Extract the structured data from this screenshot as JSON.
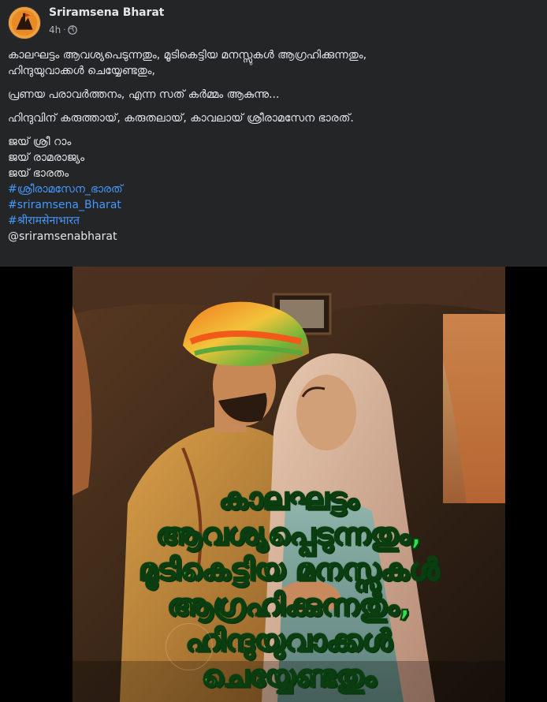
{
  "post": {
    "author": "Sriramsena Bharat",
    "time": "4h",
    "time_separator": "·",
    "audience_icon": "globe-icon",
    "caption": {
      "line1": "കാലഘട്ടം ആവശ്യപെടുന്നതും, മൂടികെട്ടിയ മനസ്സുകൾ ആഗ്രഹിക്കുന്നതും,",
      "line2": "ഹിന്ദുയുവാക്കൾ ചെയ്യേണ്ടതും,",
      "line3": "പ്രണയ പരാവർത്തനം, എന്ന സത് കർമ്മം ആകുന്നു...",
      "line4": "ഹിന്ദുവിന് കരുത്തായ്, കരുതലായ്, കാവലായ് ശ്രീരാമസേന ഭാരത്.",
      "line5": "ജയ് ശ്രീ റാം",
      "line6": "ജയ് രാമരാജ്യം",
      "line7": "ജയ്  ഭാരതം",
      "hashtag1": "#ശ്രീരാമസേന_ഭാരത്",
      "hashtag2": "#sriramsena_Bharat",
      "hashtag3": "#श्रीरामसेनाभारत",
      "mention": "@sriramsenabharat"
    },
    "image": {
      "overlay_lines": [
        "കാലഘട്ടം",
        "ആവശ്യപ്പെടുന്നതും,",
        "മൂടികെട്ടിയ മനസ്സുകൾ",
        "ആഗ്രഹിക്കുന്നതും,",
        "ഹിന്ദുയുവാക്കൾ",
        "ചെയ്യേണ്ടതും"
      ],
      "overlay_color": "#2ee04a"
    }
  },
  "colors": {
    "background": "#242526",
    "text": "#e4e6eb",
    "secondary_text": "#b0b3b8",
    "link": "#4599ff"
  }
}
